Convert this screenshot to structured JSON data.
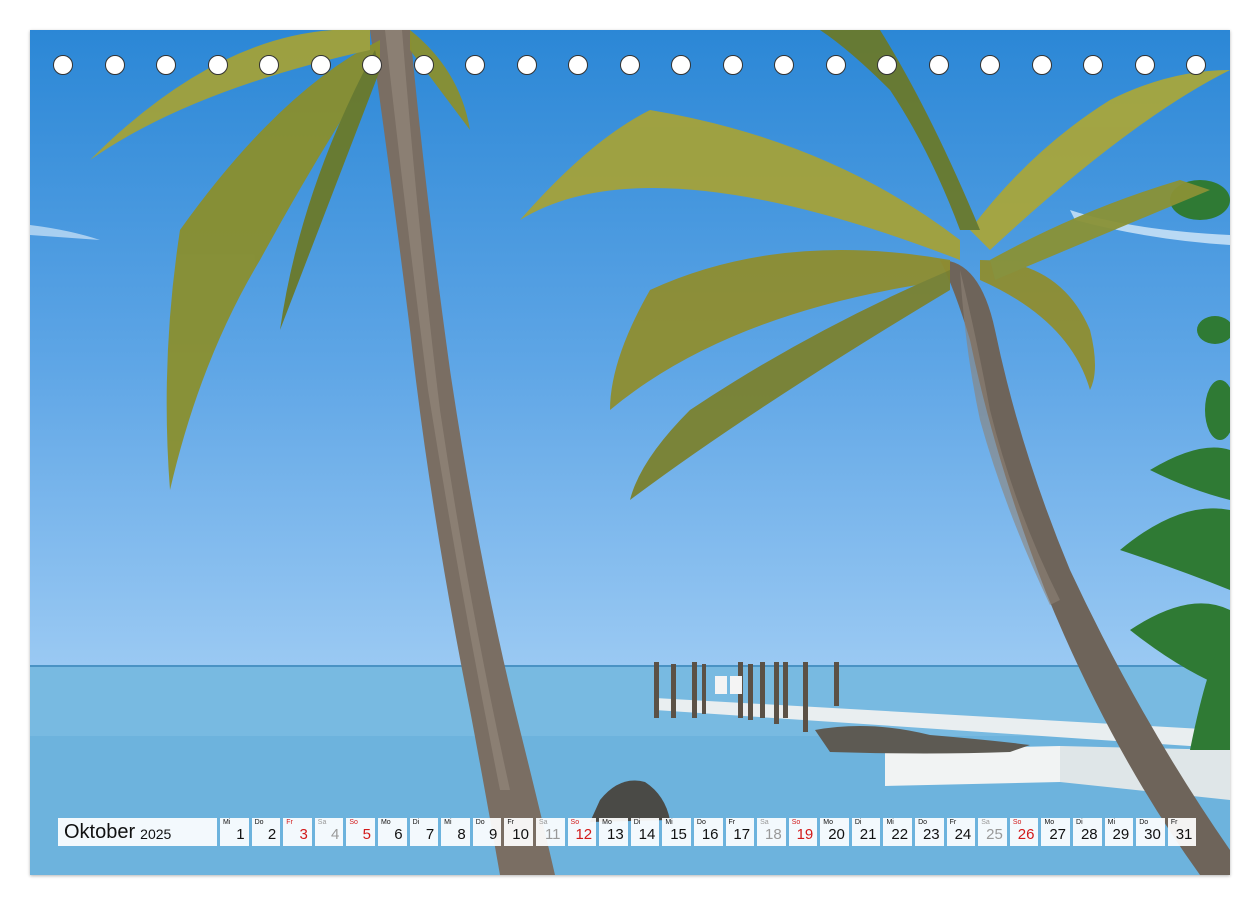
{
  "calendar": {
    "month": "Oktober",
    "year": "2025",
    "days": [
      {
        "wd": "Mi",
        "d": "1",
        "type": "weekday"
      },
      {
        "wd": "Do",
        "d": "2",
        "type": "weekday"
      },
      {
        "wd": "Fr",
        "d": "3",
        "type": "holiday"
      },
      {
        "wd": "Sa",
        "d": "4",
        "type": "sat"
      },
      {
        "wd": "So",
        "d": "5",
        "type": "sun"
      },
      {
        "wd": "Mo",
        "d": "6",
        "type": "weekday"
      },
      {
        "wd": "Di",
        "d": "7",
        "type": "weekday"
      },
      {
        "wd": "Mi",
        "d": "8",
        "type": "weekday"
      },
      {
        "wd": "Do",
        "d": "9",
        "type": "weekday"
      },
      {
        "wd": "Fr",
        "d": "10",
        "type": "weekday"
      },
      {
        "wd": "Sa",
        "d": "11",
        "type": "sat"
      },
      {
        "wd": "So",
        "d": "12",
        "type": "sun"
      },
      {
        "wd": "Mo",
        "d": "13",
        "type": "weekday"
      },
      {
        "wd": "Di",
        "d": "14",
        "type": "weekday"
      },
      {
        "wd": "Mi",
        "d": "15",
        "type": "weekday"
      },
      {
        "wd": "Do",
        "d": "16",
        "type": "weekday"
      },
      {
        "wd": "Fr",
        "d": "17",
        "type": "weekday"
      },
      {
        "wd": "Sa",
        "d": "18",
        "type": "sat"
      },
      {
        "wd": "So",
        "d": "19",
        "type": "sun"
      },
      {
        "wd": "Mo",
        "d": "20",
        "type": "weekday"
      },
      {
        "wd": "Di",
        "d": "21",
        "type": "weekday"
      },
      {
        "wd": "Mi",
        "d": "22",
        "type": "weekday"
      },
      {
        "wd": "Do",
        "d": "23",
        "type": "weekday"
      },
      {
        "wd": "Fr",
        "d": "24",
        "type": "weekday"
      },
      {
        "wd": "Sa",
        "d": "25",
        "type": "sat"
      },
      {
        "wd": "So",
        "d": "26",
        "type": "sun"
      },
      {
        "wd": "Mo",
        "d": "27",
        "type": "weekday"
      },
      {
        "wd": "Di",
        "d": "28",
        "type": "weekday"
      },
      {
        "wd": "Mi",
        "d": "29",
        "type": "weekday"
      },
      {
        "wd": "Do",
        "d": "30",
        "type": "weekday"
      },
      {
        "wd": "Fr",
        "d": "31",
        "type": "weekday"
      }
    ]
  },
  "binding": {
    "hole_count": 23
  },
  "colors": {
    "sunday": "#d21a1a",
    "saturday": "#999999",
    "sky": "#2b87d6",
    "sea": "#5aa8d6"
  }
}
